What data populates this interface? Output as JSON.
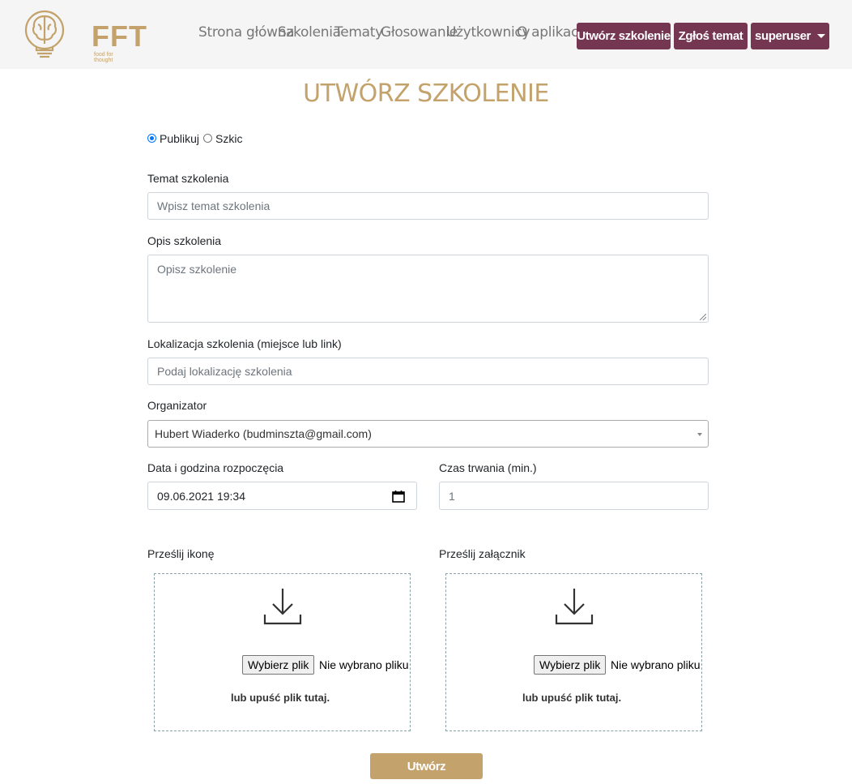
{
  "brand": {
    "name": "FFT",
    "tagline": "food for thought",
    "color": "#c3a26b"
  },
  "nav": {
    "links": [
      "Strona główna",
      "Szkolenia",
      "Tematy",
      "Głosowanie",
      "Użytkownicy",
      "O aplikacji"
    ],
    "create_training": "Utwórz szkolenie",
    "report_topic": "Zgłoś temat",
    "user": "superuser",
    "accent": "#743650"
  },
  "page": {
    "title": "UTWÓRZ SZKOLENIE"
  },
  "form": {
    "status": {
      "publish": "Publikuj",
      "draft": "Szkic",
      "selected": "Publikuj"
    },
    "topic": {
      "label": "Temat szkolenia",
      "placeholder": "Wpisz temat szkolenia"
    },
    "description": {
      "label": "Opis szkolenia",
      "placeholder": "Opisz szkolenie"
    },
    "location": {
      "label": "Lokalizacja szkolenia (miejsce lub link)",
      "placeholder": "Podaj lokalizację szkolenia"
    },
    "organizer": {
      "label": "Organizator",
      "value": "Hubert Wiaderko (budminszta@gmail.com)"
    },
    "start": {
      "label": "Data i godzina rozpoczęcia",
      "value": "09.06.2021 19:34"
    },
    "duration": {
      "label": "Czas trwania (min.)",
      "value": "1"
    },
    "icon_upload": {
      "label": "Prześlij ikonę",
      "button": "Wybierz plik",
      "no_file": "Nie wybrano pliku",
      "drop": "lub upuść plik tutaj."
    },
    "attachment_upload": {
      "label": "Prześlij załącznik",
      "button": "Wybierz plik",
      "no_file": "Nie wybrano pliku",
      "drop": "lub upuść plik tutaj."
    },
    "submit": "Utwórz"
  }
}
